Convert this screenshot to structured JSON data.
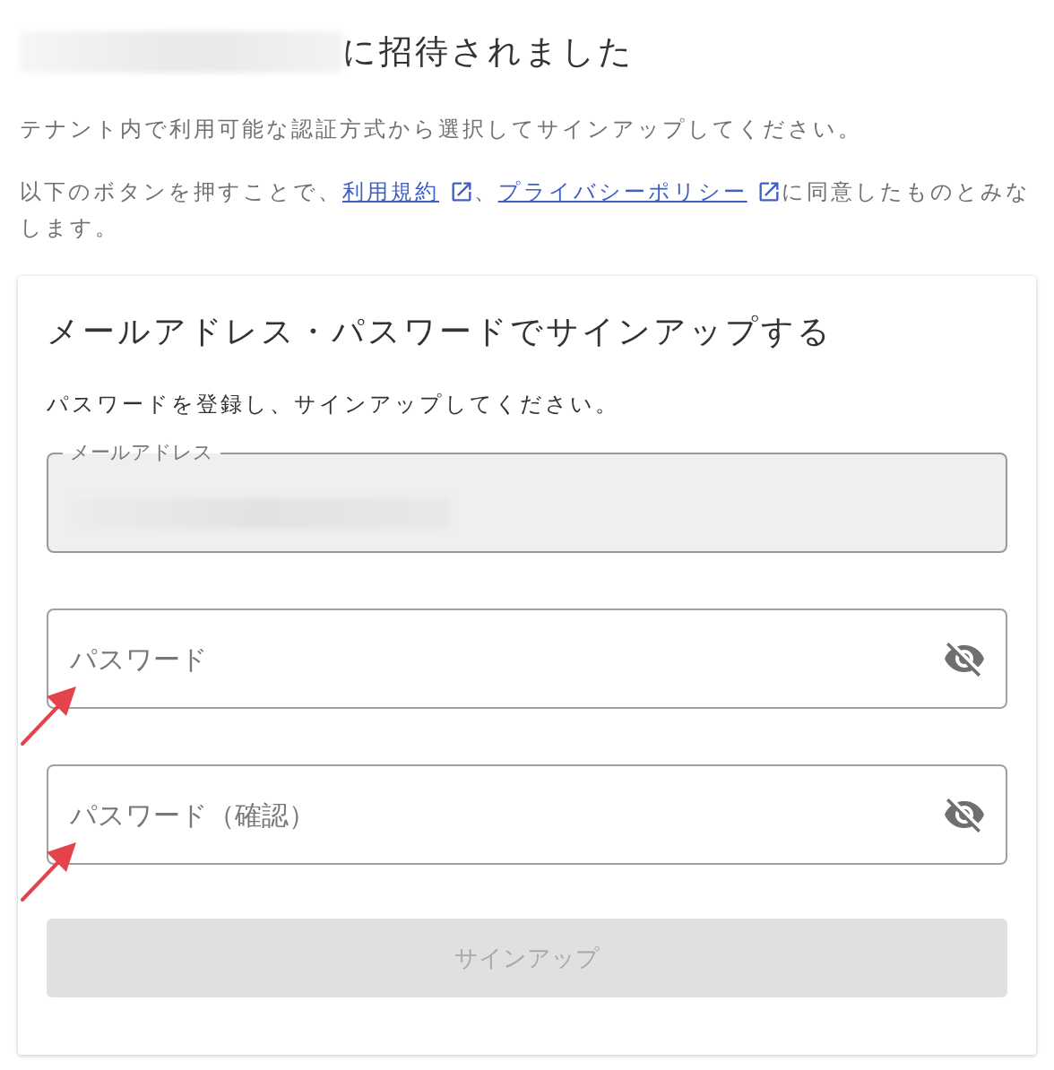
{
  "heading": {
    "text": "に招待されました",
    "name_redacted": true
  },
  "intro": "テナント内で利用可能な認証方式から選択してサインアップしてください。",
  "agreement": [
    {
      "kind": "text",
      "text": "以下のボタンを押すことで、"
    },
    {
      "kind": "link",
      "text": "利用規約"
    },
    {
      "kind": "text",
      "text": "、"
    },
    {
      "kind": "link",
      "text": "プライバシーポリシー"
    },
    {
      "kind": "text",
      "text": "に同意したものとみなします。"
    }
  ],
  "card": {
    "title": "メールアドレス・パスワードでサインアップする",
    "instruction": "パスワードを登録し、サインアップしてください。",
    "fields": [
      {
        "kind": "email",
        "label": "メールアドレス",
        "disabled": true,
        "value_redacted": true
      },
      {
        "kind": "password",
        "placeholder": "パスワード",
        "disabled": false,
        "visible": false,
        "annotated": true
      },
      {
        "kind": "password",
        "placeholder": "パスワード（確認）",
        "disabled": false,
        "visible": false,
        "annotated": true
      }
    ],
    "button": {
      "label": "サインアップ",
      "disabled": true
    }
  }
}
